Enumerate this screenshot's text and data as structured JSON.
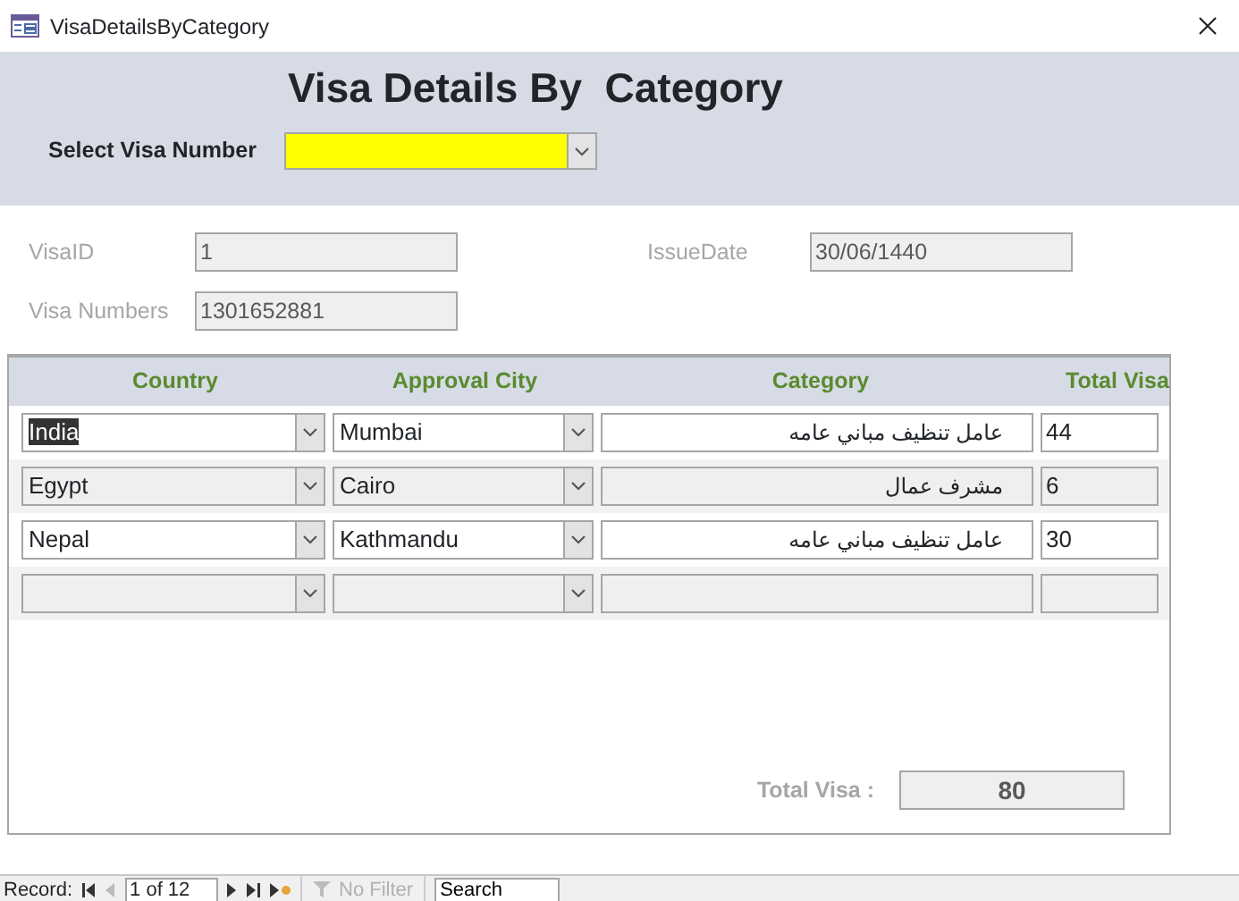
{
  "window": {
    "title": "VisaDetailsByCategory"
  },
  "header": {
    "title": "Visa Details By  Category",
    "select_label": "Select Visa Number"
  },
  "details": [
    {
      "label": "VisaID",
      "value": "1"
    },
    {
      "label": "IssueDate",
      "value": "30/06/1440"
    },
    {
      "label": "Visa Numbers",
      "value": "1301652881"
    }
  ],
  "subform": {
    "columns": [
      "Country",
      "Approval City",
      "Category",
      "Total Visa"
    ],
    "rows": [
      {
        "country": "India",
        "city": "Mumbai",
        "category": "عامل تنظيف مباني عامه",
        "total": "44",
        "selected": true
      },
      {
        "country": "Egypt",
        "city": "Cairo",
        "category": "مشرف عمال",
        "total": "6",
        "selected": false
      },
      {
        "country": "Nepal",
        "city": "Kathmandu",
        "category": "عامل تنظيف مباني عامه",
        "total": "30",
        "selected": false
      },
      {
        "selected": false
      }
    ],
    "total_label": "Total Visa :",
    "total_value": "80"
  },
  "navigation": {
    "label": "Record:",
    "position": "1 of 12",
    "filter": "No Filter",
    "filter_disabled": true,
    "search_placeholder": "Search"
  }
}
